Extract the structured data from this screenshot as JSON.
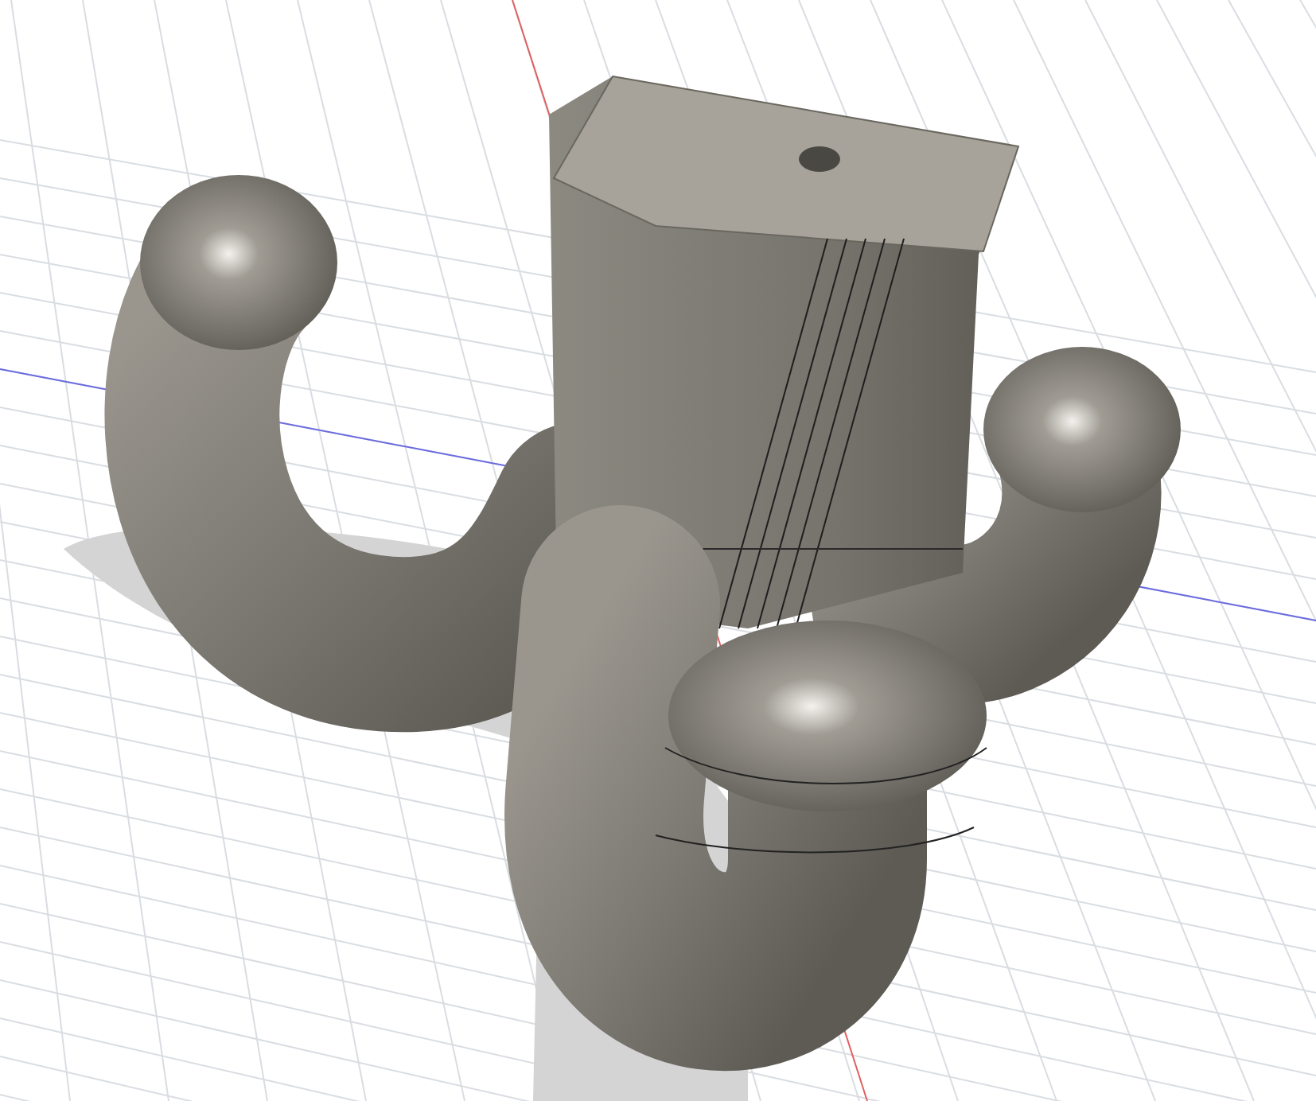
{
  "viewport": {
    "grid": true,
    "axes": true,
    "shadow": true
  }
}
